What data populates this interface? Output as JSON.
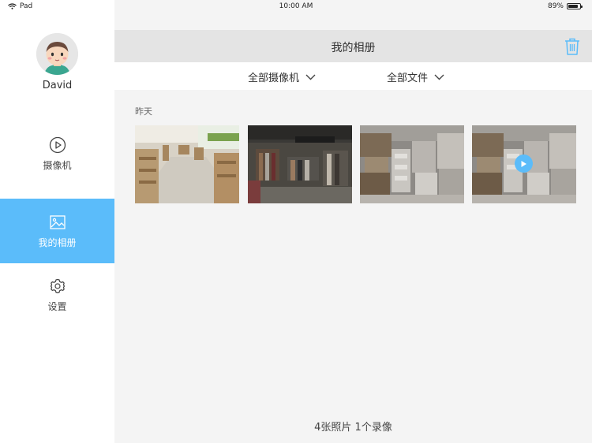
{
  "status": {
    "carrier": "Pad",
    "time": "10:00 AM",
    "battery": "89%"
  },
  "sidebar": {
    "user_name": "David",
    "items": [
      {
        "label": "摄像机",
        "icon": "play-circle-icon",
        "active": false
      },
      {
        "label": "我的相册",
        "icon": "picture-icon",
        "active": true
      },
      {
        "label": "设置",
        "icon": "gear-icon",
        "active": false
      }
    ]
  },
  "header": {
    "title": "我的相册",
    "trash_icon": "trash-icon"
  },
  "filters": [
    {
      "label": "全部摄像机",
      "icon": "chevron-down-icon"
    },
    {
      "label": "全部文件",
      "icon": "chevron-down-icon"
    }
  ],
  "gallery": {
    "date_label": "昨天",
    "items": [
      {
        "type": "photo",
        "subject": "restaurant interior"
      },
      {
        "type": "photo",
        "subject": "clothing store"
      },
      {
        "type": "photo",
        "subject": "warehouse boxes"
      },
      {
        "type": "video",
        "subject": "warehouse boxes"
      }
    ]
  },
  "footer": {
    "count_text": "4张照片 1个录像"
  },
  "colors": {
    "accent": "#5bbcfa",
    "header_bg": "#e4e4e4",
    "content_bg": "#f4f4f4"
  }
}
